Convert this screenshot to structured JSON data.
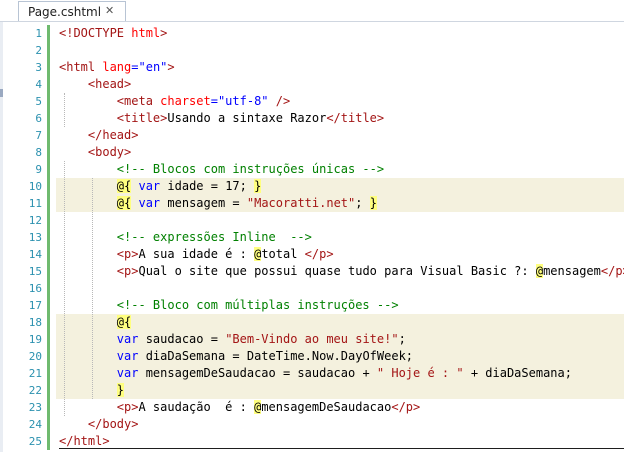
{
  "tab": {
    "title": "Page.cshtml",
    "close_icon": "close-icon"
  },
  "lines": [
    {
      "n": "1"
    },
    {
      "n": "2"
    },
    {
      "n": "3"
    },
    {
      "n": "4"
    },
    {
      "n": "5"
    },
    {
      "n": "6"
    },
    {
      "n": "7"
    },
    {
      "n": "8"
    },
    {
      "n": "9"
    },
    {
      "n": "10"
    },
    {
      "n": "11"
    },
    {
      "n": "12"
    },
    {
      "n": "13"
    },
    {
      "n": "14"
    },
    {
      "n": "15"
    },
    {
      "n": "16"
    },
    {
      "n": "17"
    },
    {
      "n": "18"
    },
    {
      "n": "19"
    },
    {
      "n": "20"
    },
    {
      "n": "21"
    },
    {
      "n": "22"
    },
    {
      "n": "23"
    },
    {
      "n": "24"
    },
    {
      "n": "25"
    }
  ],
  "code": {
    "l1": [
      [
        "t",
        "<!DOCTYPE "
      ],
      [
        "a",
        "html"
      ],
      [
        "t",
        ">"
      ]
    ],
    "l2": [],
    "l3": [
      [
        "t",
        "<html "
      ],
      [
        "a",
        "lang"
      ],
      [
        "v",
        "=\"en\""
      ],
      [
        "t",
        ">"
      ]
    ],
    "l4": [
      [
        "p",
        "    "
      ],
      [
        "t",
        "<head>"
      ]
    ],
    "l5": [
      [
        "p",
        "        "
      ],
      [
        "t",
        "<meta "
      ],
      [
        "a",
        "charset"
      ],
      [
        "v",
        "=\"utf-8\""
      ],
      [
        "t",
        " />"
      ]
    ],
    "l6": [
      [
        "p",
        "        "
      ],
      [
        "t",
        "<title>"
      ],
      [
        "p",
        "Usando a sintaxe Razor"
      ],
      [
        "t",
        "</title>"
      ]
    ],
    "l7": [
      [
        "p",
        "    "
      ],
      [
        "t",
        "</head>"
      ]
    ],
    "l8": [
      [
        "p",
        "    "
      ],
      [
        "t",
        "<body>"
      ]
    ],
    "l9": [
      [
        "p",
        "        "
      ],
      [
        "c",
        "<!-- Blocos com instruções únicas -->"
      ]
    ],
    "l10": [
      [
        "p",
        "        "
      ],
      [
        "rz",
        "@{"
      ],
      [
        "p",
        " "
      ],
      [
        "k",
        "var"
      ],
      [
        "p",
        " idade = 17; "
      ],
      [
        "rz",
        "}"
      ]
    ],
    "l11": [
      [
        "p",
        "        "
      ],
      [
        "rz",
        "@{"
      ],
      [
        "p",
        " "
      ],
      [
        "k",
        "var"
      ],
      [
        "p",
        " mensagem = "
      ],
      [
        "s",
        "\"Macoratti.net\""
      ],
      [
        "p",
        "; "
      ],
      [
        "rz",
        "}"
      ]
    ],
    "l12": [],
    "l13": [
      [
        "p",
        "        "
      ],
      [
        "c",
        "<!-- expressões Inline  -->"
      ]
    ],
    "l14": [
      [
        "p",
        "        "
      ],
      [
        "t",
        "<p>"
      ],
      [
        "p",
        "A sua idade é : "
      ],
      [
        "rz",
        "@"
      ],
      [
        "p",
        "total "
      ],
      [
        "t",
        "</p>"
      ]
    ],
    "l15": [
      [
        "p",
        "        "
      ],
      [
        "t",
        "<p>"
      ],
      [
        "p",
        "Qual o site que possui quase tudo para Visual Basic ?: "
      ],
      [
        "rz",
        "@"
      ],
      [
        "p",
        "mensagem"
      ],
      [
        "t",
        "</p>"
      ]
    ],
    "l16": [],
    "l17": [
      [
        "p",
        "        "
      ],
      [
        "c",
        "<!-- Bloco com múltiplas instruções -->"
      ]
    ],
    "l18": [
      [
        "p",
        "        "
      ],
      [
        "rz",
        "@{"
      ]
    ],
    "l19": [
      [
        "p",
        "        "
      ],
      [
        "k",
        "var"
      ],
      [
        "p",
        " saudacao = "
      ],
      [
        "s",
        "\"Bem-Vindo ao meu site!\""
      ],
      [
        "p",
        ";"
      ]
    ],
    "l20": [
      [
        "p",
        "        "
      ],
      [
        "k",
        "var"
      ],
      [
        "p",
        " diaDaSemana = DateTime.Now.DayOfWeek;"
      ]
    ],
    "l21": [
      [
        "p",
        "        "
      ],
      [
        "k",
        "var"
      ],
      [
        "p",
        " mensagemDeSaudacao = saudacao + "
      ],
      [
        "s",
        "\" Hoje é : \""
      ],
      [
        "p",
        " + diaDaSemana;"
      ]
    ],
    "l22": [
      [
        "p",
        "        "
      ],
      [
        "rz",
        "}"
      ]
    ],
    "l23": [
      [
        "p",
        "        "
      ],
      [
        "t",
        "<p>"
      ],
      [
        "p",
        "A saudação  é : "
      ],
      [
        "rz",
        "@"
      ],
      [
        "p",
        "mensagemDeSaudacao"
      ],
      [
        "t",
        "</p>"
      ]
    ],
    "l24": [
      [
        "p",
        "    "
      ],
      [
        "t",
        "</body>"
      ]
    ],
    "l25": [
      [
        "t",
        "</html>"
      ]
    ]
  },
  "highlighted_lines": [
    10,
    11,
    18,
    19,
    20,
    21,
    22
  ],
  "changed_lines": [
    1,
    2,
    3,
    4,
    5,
    6,
    7,
    8,
    9,
    10,
    11,
    12,
    13,
    14,
    15,
    16,
    17,
    18,
    19,
    20,
    21,
    22,
    23,
    24,
    25
  ],
  "colors": {
    "tag": "#a31515",
    "attr": "#ff0000",
    "value": "#0000ff",
    "keyword": "#0000ff",
    "comment": "#008000",
    "razor_bg": "#ffff80",
    "highlight_bg": "#f4f1de",
    "line_number": "#2b91af",
    "change_bar": "#6fba6f"
  }
}
